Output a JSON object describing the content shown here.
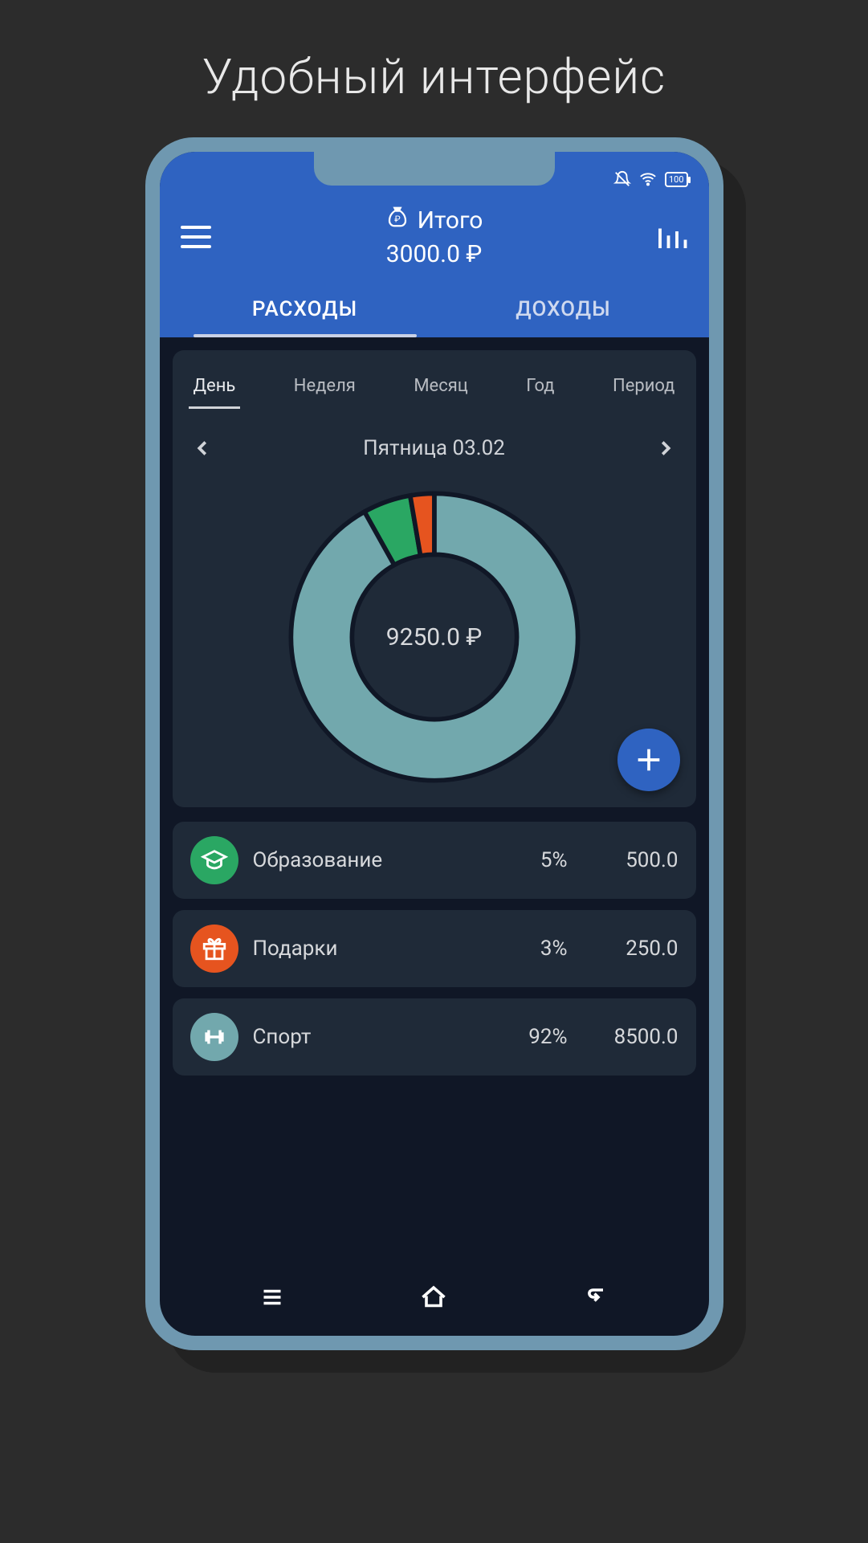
{
  "page_caption": "Удобный интерфейс",
  "status": {
    "battery": "100"
  },
  "header": {
    "title_label": "Итого",
    "balance": "3000.0 ₽"
  },
  "main_tabs": [
    {
      "label": "РАСХОДЫ",
      "active": true
    },
    {
      "label": "ДОХОДЫ",
      "active": false
    }
  ],
  "period_tabs": [
    {
      "label": "День",
      "active": true
    },
    {
      "label": "Неделя",
      "active": false
    },
    {
      "label": "Месяц",
      "active": false
    },
    {
      "label": "Год",
      "active": false
    },
    {
      "label": "Период",
      "active": false
    }
  ],
  "date_label": "Пятница 03.02",
  "donut_center": "9250.0 ₽",
  "categories": [
    {
      "icon": "education-icon",
      "color": "#2aa763",
      "name": "Образование",
      "percent": "5%",
      "value": "500.0"
    },
    {
      "icon": "gift-icon",
      "color": "#e6541f",
      "name": "Подарки",
      "percent": "3%",
      "value": "250.0"
    },
    {
      "icon": "sport-icon",
      "color": "#72a8ad",
      "name": "Спорт",
      "percent": "92%",
      "value": "8500.0"
    }
  ],
  "chart_data": {
    "type": "pie",
    "title": "",
    "center_label": "9250.0 ₽",
    "series": [
      {
        "name": "Образование",
        "value": 500.0,
        "percent": 5,
        "color": "#2aa763"
      },
      {
        "name": "Подарки",
        "value": 250.0,
        "percent": 3,
        "color": "#e6541f"
      },
      {
        "name": "Спорт",
        "value": 8500.0,
        "percent": 92,
        "color": "#72a8ad"
      }
    ],
    "total": 9250.0,
    "currency": "₽"
  }
}
